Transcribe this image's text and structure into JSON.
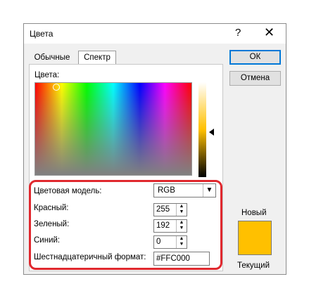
{
  "dialog": {
    "title": "Цвета",
    "help_glyph": "?",
    "close_glyph": "✕"
  },
  "tabs": [
    {
      "label": "Обычные"
    },
    {
      "label": "Спектр"
    }
  ],
  "spectrum": {
    "label": "Цвета:"
  },
  "fields": {
    "model_label": "Цветовая модель:",
    "model_value": "RGB",
    "red_label": "Красный:",
    "red_value": "255",
    "green_label": "Зеленый:",
    "green_value": "192",
    "blue_label": "Синий:",
    "blue_value": "0",
    "hex_label": "Шестнадцатеричный формат:",
    "hex_value": "#FFC000"
  },
  "buttons": {
    "ok": "ОК",
    "cancel": "Отмена"
  },
  "preview": {
    "new_label": "Новый",
    "current_label": "Текущий",
    "color": "#FFC000"
  },
  "colors": {
    "highlight": "#e0282e",
    "accent": "#0078d7"
  }
}
